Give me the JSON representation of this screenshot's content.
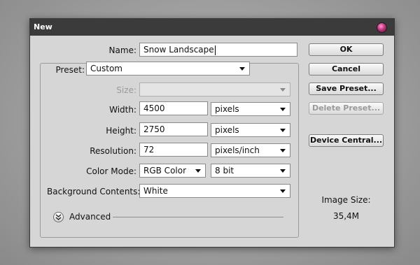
{
  "window": {
    "title": "New"
  },
  "form": {
    "name_label": "Name:",
    "name_value": "Snow Landscape",
    "preset_label": "Preset:",
    "preset_value": "Custom",
    "size_label": "Size:",
    "size_value": "",
    "width_label": "Width:",
    "width_value": "4500",
    "width_unit": "pixels",
    "height_label": "Height:",
    "height_value": "2750",
    "height_unit": "pixels",
    "resolution_label": "Resolution:",
    "resolution_value": "72",
    "resolution_unit": "pixels/inch",
    "color_mode_label": "Color Mode:",
    "color_mode_value": "RGB Color",
    "bit_depth_value": "8 bit",
    "background_label": "Background Contents:",
    "background_value": "White",
    "advanced_label": "Advanced"
  },
  "buttons": {
    "ok": "OK",
    "cancel": "Cancel",
    "save_preset": "Save Preset...",
    "delete_preset": "Delete Preset...",
    "device_central": "Device Central..."
  },
  "info": {
    "image_size_label": "Image Size:",
    "image_size_value": "35,4M"
  }
}
